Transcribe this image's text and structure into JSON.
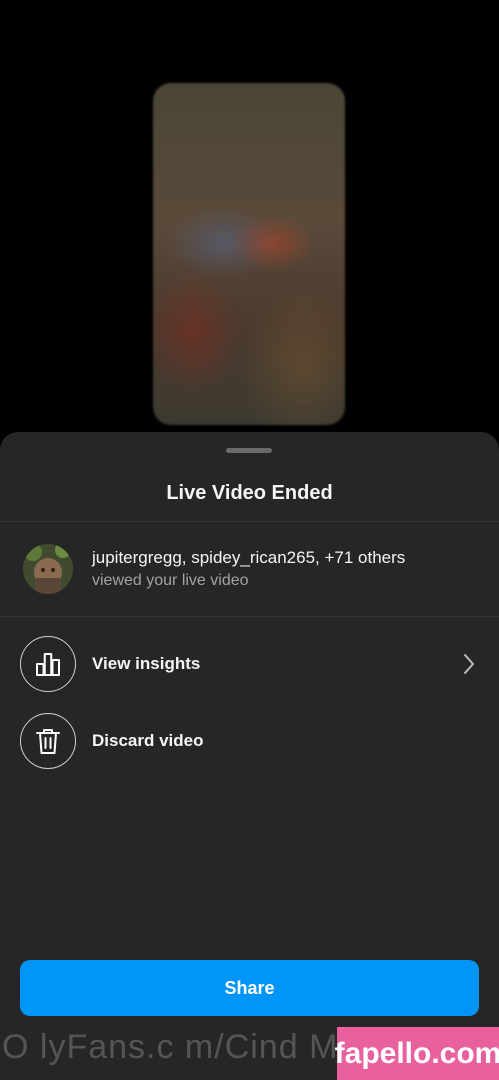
{
  "sheet": {
    "title": "Live Video Ended"
  },
  "viewers": {
    "names": "jupitergregg, spidey_rican265, +71 others",
    "subtitle": "viewed your live video"
  },
  "actions": [
    {
      "label": "View insights",
      "icon": "bar-chart-icon"
    },
    {
      "label": "Discard video",
      "icon": "trash-icon"
    }
  ],
  "share": {
    "label": "Share"
  },
  "watermarks": {
    "left": "O lyFans.c m/Cind  M    7",
    "right": "fapello.com"
  },
  "colors": {
    "sheet_background": "#262626",
    "share_button": "#0095f6",
    "watermark_badge": "#e8609e"
  }
}
